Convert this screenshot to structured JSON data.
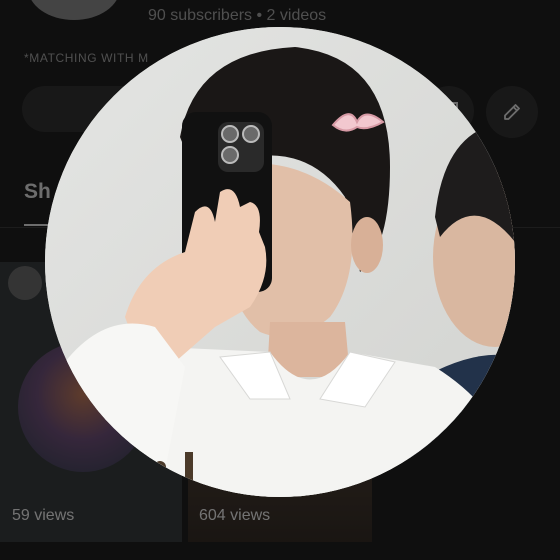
{
  "channel": {
    "stats": "90 subscribers • 2 videos",
    "description_snippet": "*MATCHING WITH M"
  },
  "tabs": [
    {
      "label": "Sh"
    }
  ],
  "videos": [
    {
      "views": "59 views"
    },
    {
      "views": "604 views"
    }
  ],
  "icons": {
    "edit": "pencil-icon",
    "square": "square-icon"
  },
  "colors": {
    "background": "#0f0f0f",
    "secondary_text": "#aaaaaa",
    "button_bg": "#272727"
  }
}
